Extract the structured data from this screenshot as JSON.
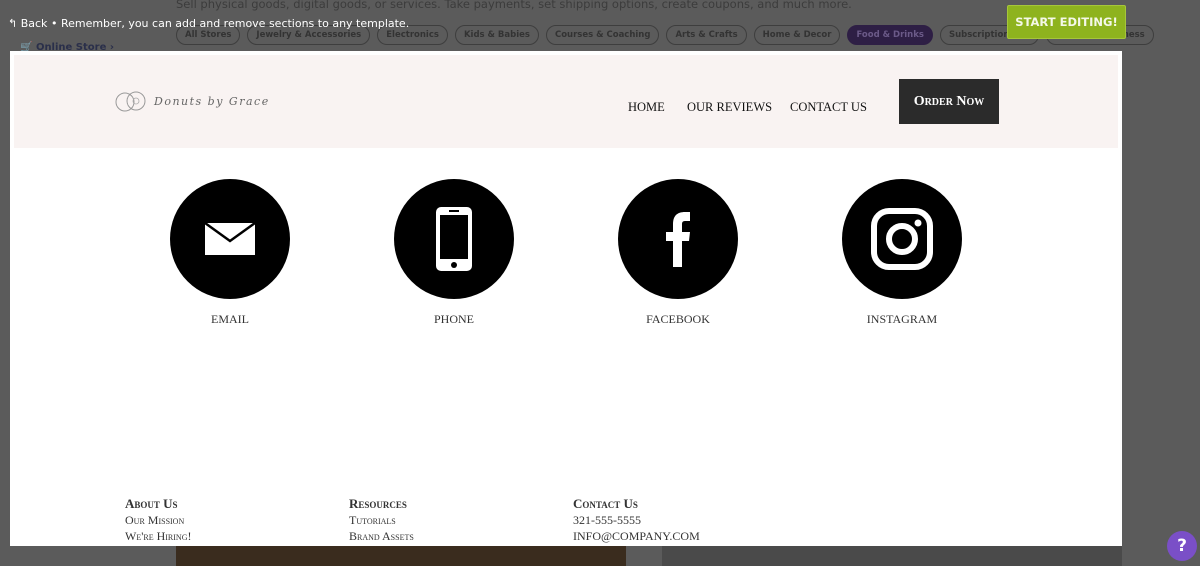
{
  "background": {
    "subtitle": "Sell physical goods, digital goods, or services. Take payments, set shipping options, create coupons, and much more.",
    "online_store": "Online Store  ›",
    "categories": [
      "All Stores",
      "Jewelry & Accessories",
      "Electronics",
      "Kids & Babies",
      "Courses & Coaching",
      "Arts & Crafts",
      "Home & Decor",
      "Food & Drinks",
      "Subscription Box",
      "Beauty & Wellness"
    ],
    "active_category": "Food & Drinks"
  },
  "topbar": {
    "back": "Back",
    "separator": "•",
    "message": "Remember, you can add and remove sections to any template.",
    "start_editing": "START EDITING!"
  },
  "preview": {
    "brand": "Donuts by Grace",
    "nav": [
      "HOME",
      "OUR REVIEWS",
      "CONTACT US"
    ],
    "order_button": "Order Now",
    "social": [
      {
        "label": "EMAIL",
        "icon": "envelope-icon"
      },
      {
        "label": "PHONE",
        "icon": "phone-icon"
      },
      {
        "label": "FACEBOOK",
        "icon": "facebook-icon"
      },
      {
        "label": "INSTAGRAM",
        "icon": "instagram-icon"
      }
    ],
    "footer": [
      {
        "heading": "About Us",
        "items": [
          "Our Mission",
          "We're Hiring!"
        ]
      },
      {
        "heading": "Resources",
        "items": [
          "Tutorials",
          "Brand Assets"
        ]
      },
      {
        "heading": "Contact Us",
        "items": [
          "321-555-5555",
          "INFO@COMPANY.COM"
        ]
      }
    ]
  },
  "help": "?",
  "colors": {
    "accent_green": "#8eb31e",
    "active_pill": "#2e1f45",
    "header_bg": "#f9f3f2",
    "help": "#7a4fc7"
  }
}
